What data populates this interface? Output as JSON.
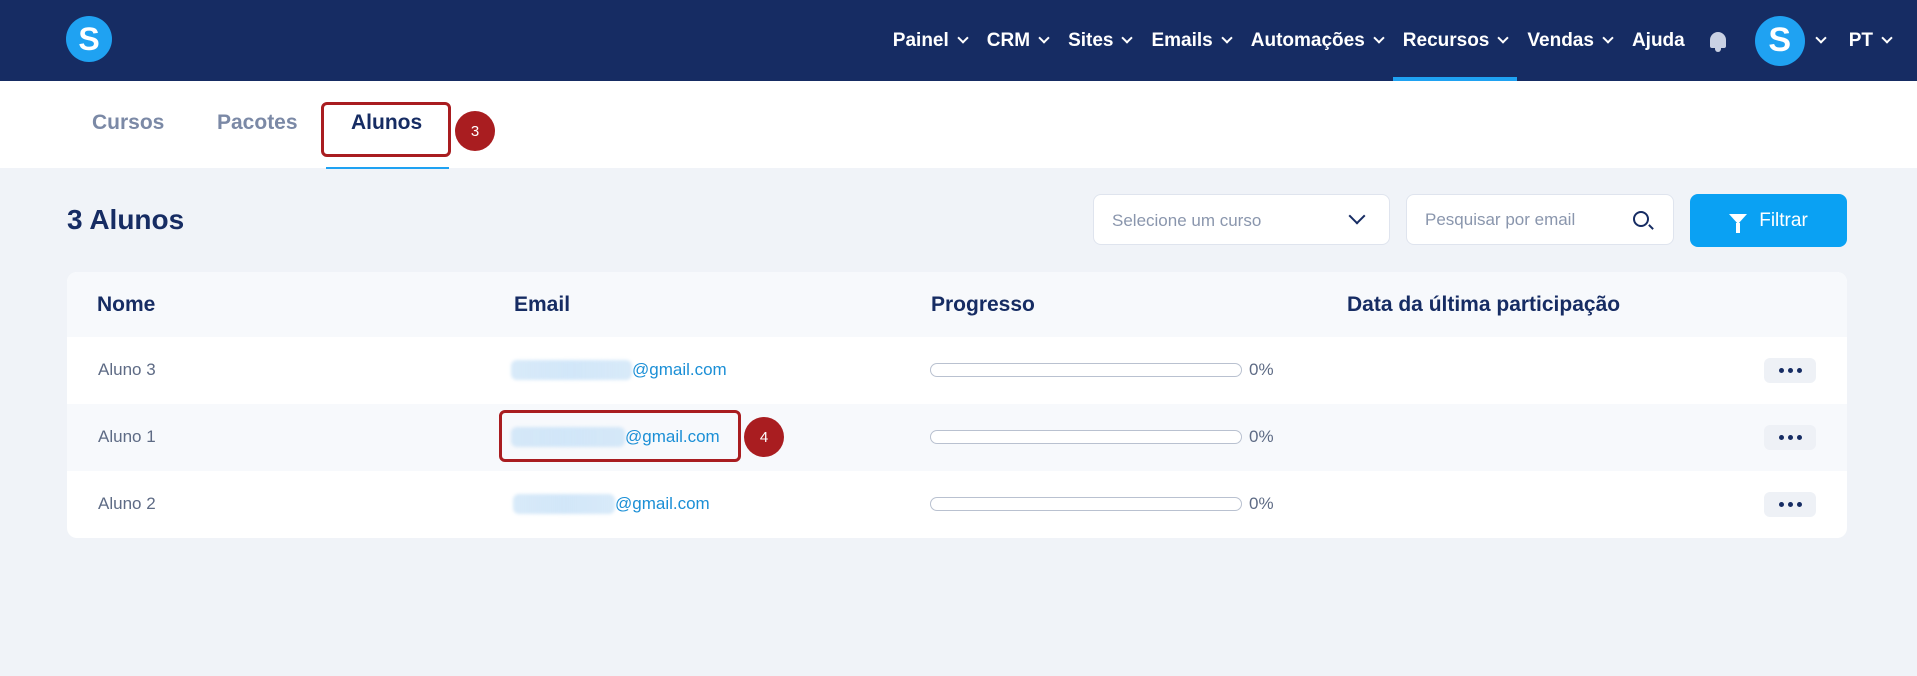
{
  "brand": {
    "logo_letter": "S",
    "accent": "#1fa2f2",
    "nav_bg": "#162c63"
  },
  "nav": {
    "items": [
      {
        "label": "Painel",
        "dropdown": true,
        "active": false
      },
      {
        "label": "CRM",
        "dropdown": true,
        "active": false
      },
      {
        "label": "Sites",
        "dropdown": true,
        "active": false
      },
      {
        "label": "Emails",
        "dropdown": true,
        "active": false
      },
      {
        "label": "Automações",
        "dropdown": true,
        "active": false
      },
      {
        "label": "Recursos",
        "dropdown": true,
        "active": true
      },
      {
        "label": "Vendas",
        "dropdown": true,
        "active": false
      },
      {
        "label": "Ajuda",
        "dropdown": false,
        "active": false
      }
    ],
    "notifications_icon": "bell-icon",
    "avatar_letter": "S",
    "language": "PT"
  },
  "tabs": [
    {
      "label": "Cursos",
      "active": false
    },
    {
      "label": "Pacotes",
      "active": false
    },
    {
      "label": "Alunos",
      "active": true
    }
  ],
  "annotations": {
    "tab_step": "3",
    "email_step": "4",
    "highlight_color": "#a91d20"
  },
  "toolbar": {
    "count_title": "3 Alunos",
    "course_select_placeholder": "Selecione um curso",
    "search_placeholder": "Pesquisar por email",
    "filter_label": "Filtrar"
  },
  "table": {
    "headers": {
      "name": "Nome",
      "email": "Email",
      "progress": "Progresso",
      "last_participation": "Data da última participação"
    },
    "rows": [
      {
        "name": "Aluno 3",
        "email_domain": "@gmail.com",
        "progress": 0,
        "progress_label": "0%",
        "last_participation": ""
      },
      {
        "name": "Aluno 1",
        "email_domain": "@gmail.com",
        "progress": 0,
        "progress_label": "0%",
        "last_participation": ""
      },
      {
        "name": "Aluno 2",
        "email_domain": "@gmail.com",
        "progress": 0,
        "progress_label": "0%",
        "last_participation": ""
      }
    ]
  }
}
